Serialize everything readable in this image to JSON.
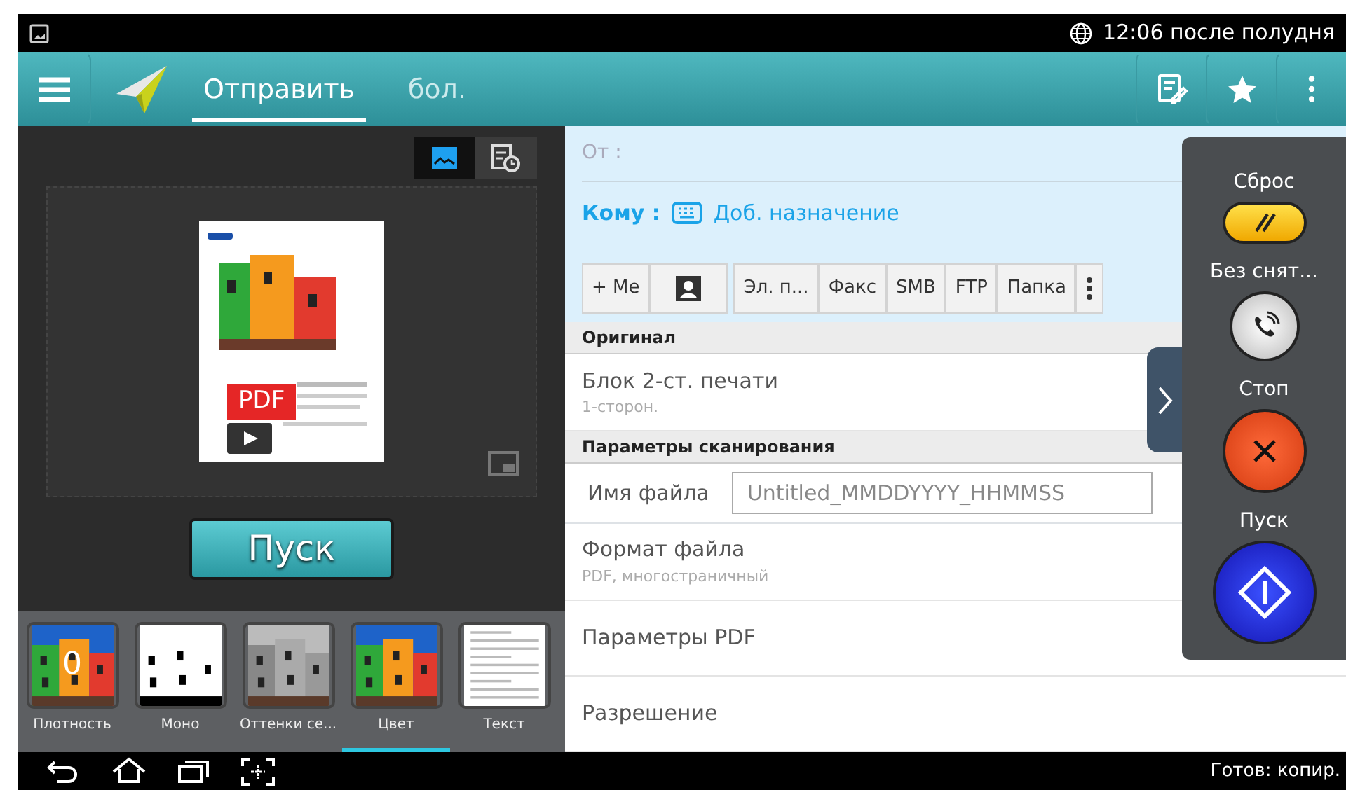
{
  "status_bar": {
    "time": "12:06 после полудня"
  },
  "app_bar": {
    "tabs": [
      {
        "label": "Отправить",
        "selected": true
      },
      {
        "label": "бол.",
        "selected": false
      }
    ]
  },
  "preview": {
    "view_modes": [
      {
        "selected": true
      },
      {
        "selected": false
      }
    ],
    "badge": "PDF"
  },
  "start_button": "Пуск",
  "thumbnails": [
    {
      "kind": "color",
      "label": "Плотность",
      "value": "0",
      "selected": false
    },
    {
      "kind": "mono",
      "label": "Моно",
      "selected": false
    },
    {
      "kind": "gray",
      "label": "Оттенки се...",
      "selected": false
    },
    {
      "kind": "color",
      "label": "Цвет",
      "selected": true
    },
    {
      "kind": "text",
      "label": "Текст",
      "selected": false
    }
  ],
  "recipients": {
    "from_label": "От :",
    "to_label": "Кому :",
    "add_link": "Доб. назначение"
  },
  "destination_buttons": [
    {
      "kind": "text",
      "label": "+ Me"
    },
    {
      "kind": "contacts"
    },
    {
      "kind": "text",
      "label": "Эл. п..."
    },
    {
      "kind": "text",
      "label": "Факс"
    },
    {
      "kind": "text",
      "label": "SMB"
    },
    {
      "kind": "text",
      "label": "FTP"
    },
    {
      "kind": "text",
      "label": "Папка"
    },
    {
      "kind": "more"
    }
  ],
  "sections": [
    {
      "header": "Оригинал",
      "items": [
        {
          "kind": "setting",
          "title": "Блок 2-ст. печати",
          "value": "1-сторон."
        }
      ]
    },
    {
      "header": "Параметры сканирования",
      "items": [
        {
          "kind": "field",
          "title": "Имя файла",
          "value": "Untitled_MMDDYYYY_HHMMSS"
        },
        {
          "kind": "setting",
          "title": "Формат файла",
          "value": "PDF, многостраничный"
        },
        {
          "kind": "setting",
          "title": "Параметры PDF"
        },
        {
          "kind": "setting",
          "title": "Разрешение"
        }
      ]
    }
  ],
  "quick_panel": [
    {
      "kind": "reset",
      "label": "Сброс"
    },
    {
      "kind": "no_interrupt",
      "label": "Без снят..."
    },
    {
      "kind": "stop",
      "label": "Стоп"
    },
    {
      "kind": "start",
      "label": "Пуск"
    }
  ],
  "nav_bar": {
    "status": "Готов: копир."
  }
}
